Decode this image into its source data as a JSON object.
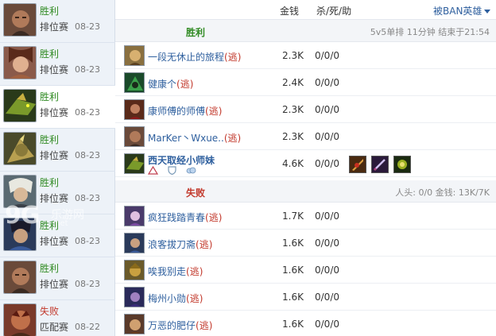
{
  "header": {
    "gold_label": "金钱",
    "kda_label": "杀/死/助",
    "ban_label": "被BAN英雄"
  },
  "history": [
    {
      "result": "胜利",
      "result_type": "win",
      "mode": "排位赛",
      "date": "08-23",
      "selected": false
    },
    {
      "result": "胜利",
      "result_type": "win",
      "mode": "排位赛",
      "date": "08-23",
      "selected": false
    },
    {
      "result": "胜利",
      "result_type": "win",
      "mode": "排位赛",
      "date": "08-23",
      "selected": true
    },
    {
      "result": "胜利",
      "result_type": "win",
      "mode": "排位赛",
      "date": "08-23",
      "selected": false
    },
    {
      "result": "胜利",
      "result_type": "win",
      "mode": "排位赛",
      "date": "08-23",
      "selected": false
    },
    {
      "result": "胜利",
      "result_type": "win",
      "mode": "排位赛",
      "date": "08-23",
      "selected": false
    },
    {
      "result": "胜利",
      "result_type": "win",
      "mode": "排位赛",
      "date": "08-23",
      "selected": false
    },
    {
      "result": "失败",
      "result_type": "lose",
      "mode": "匹配赛",
      "date": "08-22",
      "selected": false
    }
  ],
  "winning_team": {
    "result": "胜利",
    "match_info": "5v5单排 11分钟 结束于21:54",
    "players": [
      {
        "name": "一段无休止的旅程",
        "escape": "(逃)",
        "gold": "2.3K",
        "kda": "0/0/0"
      },
      {
        "name": "健康个",
        "escape": "(逃)",
        "gold": "2.4K",
        "kda": "0/0/0"
      },
      {
        "name": "康师傅的师傅",
        "escape": "(逃)",
        "gold": "2.3K",
        "kda": "0/0/0"
      },
      {
        "name": "MarKer丶Wxue..",
        "escape": "(逃)",
        "gold": "2.3K",
        "kda": "0/0/0"
      },
      {
        "name": "西天取经小师妹",
        "escape": "",
        "gold": "4.6K",
        "kda": "0/0/0"
      }
    ]
  },
  "losing_team": {
    "result": "失败",
    "summary": "人头: 0/0 金钱: 13K/7K",
    "players": [
      {
        "name": "疯狂践踏青春",
        "escape": "(逃)",
        "gold": "1.7K",
        "kda": "0/0/0"
      },
      {
        "name": "浪客拔刀斋",
        "escape": "(逃)",
        "gold": "1.6K",
        "kda": "0/0/0"
      },
      {
        "name": "唉我别走",
        "escape": "(逃)",
        "gold": "1.6K",
        "kda": "0/0/0"
      },
      {
        "name": "梅州小勋",
        "escape": "(逃)",
        "gold": "1.6K",
        "kda": "0/0/0"
      },
      {
        "name": "万恶的肥仔",
        "escape": "(逃)",
        "gold": "1.6K",
        "kda": "0/0/0"
      }
    ]
  },
  "colors": {
    "win": "#2f8a22",
    "lose": "#c2382b",
    "link": "#2e5f9e",
    "sidebar_bg": "#edf2f8"
  },
  "watermark": {
    "brand": "9G",
    "name": "乐游网",
    "sub": ".net"
  }
}
